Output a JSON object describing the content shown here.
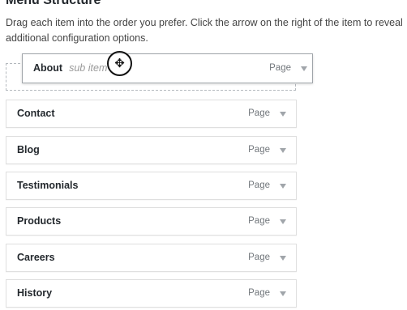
{
  "header": {
    "title": "Menu Structure",
    "instructions": "Drag each item into the order you prefer. Click the arrow on the right of the item to reveal additional configuration options."
  },
  "dragging_item": {
    "title": "About",
    "sub_label": "sub item",
    "type": "Page",
    "arrow_icon": "triangle-down-icon"
  },
  "cursor": {
    "icon": "move-icon",
    "glyph": "✥"
  },
  "menu_items": [
    {
      "title": "Contact",
      "type": "Page"
    },
    {
      "title": "Blog",
      "type": "Page"
    },
    {
      "title": "Testimonials",
      "type": "Page"
    },
    {
      "title": "Products",
      "type": "Page"
    },
    {
      "title": "Careers",
      "type": "Page"
    },
    {
      "title": "History",
      "type": "Page"
    }
  ],
  "colors": {
    "border": "#dfdfdf",
    "drag_border": "#a0a5aa",
    "text": "#23282d",
    "muted": "#72777c"
  }
}
